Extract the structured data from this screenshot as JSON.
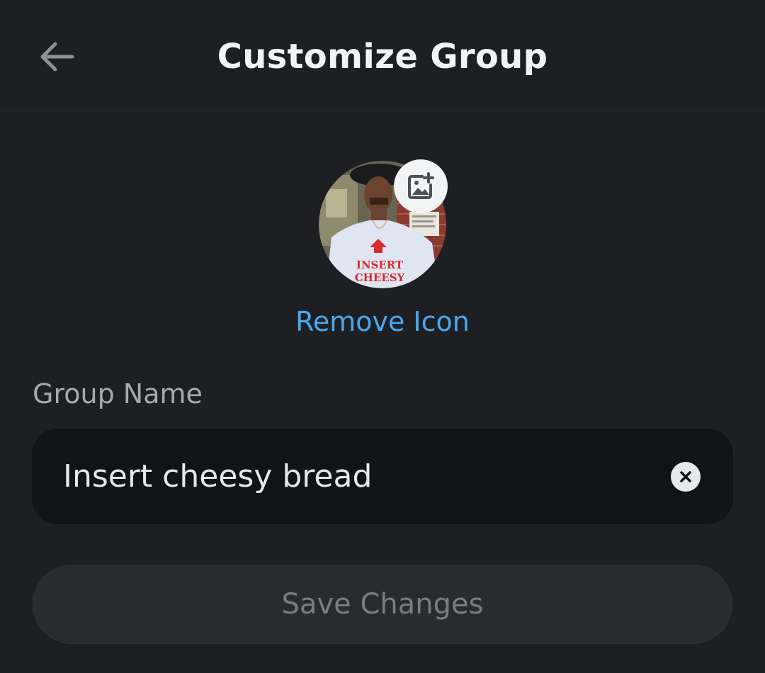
{
  "header": {
    "title": "Customize Group",
    "back_icon": "arrow-left-icon"
  },
  "group_icon": {
    "avatar": "group-avatar-photo",
    "shirt_text": [
      "INSERT",
      "CHEESY"
    ],
    "add_icon": "image-plus-icon",
    "remove_label": "Remove Icon"
  },
  "form": {
    "group_name_label": "Group Name",
    "group_name_value": "Insert cheesy bread",
    "clear_icon": "clear-x-icon"
  },
  "actions": {
    "save_label": "Save Changes"
  },
  "colors": {
    "background": "#1e1f22",
    "link": "#4aa7f0",
    "input_bg": "#121316",
    "button_bg": "#2a2b2f"
  }
}
